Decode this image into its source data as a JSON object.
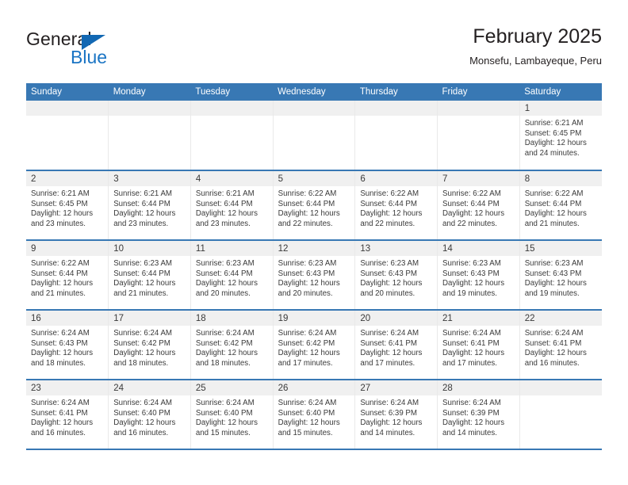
{
  "brand": {
    "name_part1": "General",
    "name_part2": "Blue",
    "logo_icon": "triangle-flag-icon",
    "accent_color": "#1268b3"
  },
  "header": {
    "title": "February 2025",
    "subtitle": "Monsefu, Lambayeque, Peru"
  },
  "theme": {
    "header_blue": "#3878b4",
    "daynum_band": "#f0f0f0",
    "text": "#3a3a3a"
  },
  "calendar": {
    "weekday_headers": [
      "Sunday",
      "Monday",
      "Tuesday",
      "Wednesday",
      "Thursday",
      "Friday",
      "Saturday"
    ],
    "weeks": [
      [
        {
          "empty": true
        },
        {
          "empty": true
        },
        {
          "empty": true
        },
        {
          "empty": true
        },
        {
          "empty": true
        },
        {
          "empty": true
        },
        {
          "day": "1",
          "sunrise": "Sunrise: 6:21 AM",
          "sunset": "Sunset: 6:45 PM",
          "daylight_line1": "Daylight: 12 hours",
          "daylight_line2": "and 24 minutes."
        }
      ],
      [
        {
          "day": "2",
          "sunrise": "Sunrise: 6:21 AM",
          "sunset": "Sunset: 6:45 PM",
          "daylight_line1": "Daylight: 12 hours",
          "daylight_line2": "and 23 minutes."
        },
        {
          "day": "3",
          "sunrise": "Sunrise: 6:21 AM",
          "sunset": "Sunset: 6:44 PM",
          "daylight_line1": "Daylight: 12 hours",
          "daylight_line2": "and 23 minutes."
        },
        {
          "day": "4",
          "sunrise": "Sunrise: 6:21 AM",
          "sunset": "Sunset: 6:44 PM",
          "daylight_line1": "Daylight: 12 hours",
          "daylight_line2": "and 23 minutes."
        },
        {
          "day": "5",
          "sunrise": "Sunrise: 6:22 AM",
          "sunset": "Sunset: 6:44 PM",
          "daylight_line1": "Daylight: 12 hours",
          "daylight_line2": "and 22 minutes."
        },
        {
          "day": "6",
          "sunrise": "Sunrise: 6:22 AM",
          "sunset": "Sunset: 6:44 PM",
          "daylight_line1": "Daylight: 12 hours",
          "daylight_line2": "and 22 minutes."
        },
        {
          "day": "7",
          "sunrise": "Sunrise: 6:22 AM",
          "sunset": "Sunset: 6:44 PM",
          "daylight_line1": "Daylight: 12 hours",
          "daylight_line2": "and 22 minutes."
        },
        {
          "day": "8",
          "sunrise": "Sunrise: 6:22 AM",
          "sunset": "Sunset: 6:44 PM",
          "daylight_line1": "Daylight: 12 hours",
          "daylight_line2": "and 21 minutes."
        }
      ],
      [
        {
          "day": "9",
          "sunrise": "Sunrise: 6:22 AM",
          "sunset": "Sunset: 6:44 PM",
          "daylight_line1": "Daylight: 12 hours",
          "daylight_line2": "and 21 minutes."
        },
        {
          "day": "10",
          "sunrise": "Sunrise: 6:23 AM",
          "sunset": "Sunset: 6:44 PM",
          "daylight_line1": "Daylight: 12 hours",
          "daylight_line2": "and 21 minutes."
        },
        {
          "day": "11",
          "sunrise": "Sunrise: 6:23 AM",
          "sunset": "Sunset: 6:44 PM",
          "daylight_line1": "Daylight: 12 hours",
          "daylight_line2": "and 20 minutes."
        },
        {
          "day": "12",
          "sunrise": "Sunrise: 6:23 AM",
          "sunset": "Sunset: 6:43 PM",
          "daylight_line1": "Daylight: 12 hours",
          "daylight_line2": "and 20 minutes."
        },
        {
          "day": "13",
          "sunrise": "Sunrise: 6:23 AM",
          "sunset": "Sunset: 6:43 PM",
          "daylight_line1": "Daylight: 12 hours",
          "daylight_line2": "and 20 minutes."
        },
        {
          "day": "14",
          "sunrise": "Sunrise: 6:23 AM",
          "sunset": "Sunset: 6:43 PM",
          "daylight_line1": "Daylight: 12 hours",
          "daylight_line2": "and 19 minutes."
        },
        {
          "day": "15",
          "sunrise": "Sunrise: 6:23 AM",
          "sunset": "Sunset: 6:43 PM",
          "daylight_line1": "Daylight: 12 hours",
          "daylight_line2": "and 19 minutes."
        }
      ],
      [
        {
          "day": "16",
          "sunrise": "Sunrise: 6:24 AM",
          "sunset": "Sunset: 6:43 PM",
          "daylight_line1": "Daylight: 12 hours",
          "daylight_line2": "and 18 minutes."
        },
        {
          "day": "17",
          "sunrise": "Sunrise: 6:24 AM",
          "sunset": "Sunset: 6:42 PM",
          "daylight_line1": "Daylight: 12 hours",
          "daylight_line2": "and 18 minutes."
        },
        {
          "day": "18",
          "sunrise": "Sunrise: 6:24 AM",
          "sunset": "Sunset: 6:42 PM",
          "daylight_line1": "Daylight: 12 hours",
          "daylight_line2": "and 18 minutes."
        },
        {
          "day": "19",
          "sunrise": "Sunrise: 6:24 AM",
          "sunset": "Sunset: 6:42 PM",
          "daylight_line1": "Daylight: 12 hours",
          "daylight_line2": "and 17 minutes."
        },
        {
          "day": "20",
          "sunrise": "Sunrise: 6:24 AM",
          "sunset": "Sunset: 6:41 PM",
          "daylight_line1": "Daylight: 12 hours",
          "daylight_line2": "and 17 minutes."
        },
        {
          "day": "21",
          "sunrise": "Sunrise: 6:24 AM",
          "sunset": "Sunset: 6:41 PM",
          "daylight_line1": "Daylight: 12 hours",
          "daylight_line2": "and 17 minutes."
        },
        {
          "day": "22",
          "sunrise": "Sunrise: 6:24 AM",
          "sunset": "Sunset: 6:41 PM",
          "daylight_line1": "Daylight: 12 hours",
          "daylight_line2": "and 16 minutes."
        }
      ],
      [
        {
          "day": "23",
          "sunrise": "Sunrise: 6:24 AM",
          "sunset": "Sunset: 6:41 PM",
          "daylight_line1": "Daylight: 12 hours",
          "daylight_line2": "and 16 minutes."
        },
        {
          "day": "24",
          "sunrise": "Sunrise: 6:24 AM",
          "sunset": "Sunset: 6:40 PM",
          "daylight_line1": "Daylight: 12 hours",
          "daylight_line2": "and 16 minutes."
        },
        {
          "day": "25",
          "sunrise": "Sunrise: 6:24 AM",
          "sunset": "Sunset: 6:40 PM",
          "daylight_line1": "Daylight: 12 hours",
          "daylight_line2": "and 15 minutes."
        },
        {
          "day": "26",
          "sunrise": "Sunrise: 6:24 AM",
          "sunset": "Sunset: 6:40 PM",
          "daylight_line1": "Daylight: 12 hours",
          "daylight_line2": "and 15 minutes."
        },
        {
          "day": "27",
          "sunrise": "Sunrise: 6:24 AM",
          "sunset": "Sunset: 6:39 PM",
          "daylight_line1": "Daylight: 12 hours",
          "daylight_line2": "and 14 minutes."
        },
        {
          "day": "28",
          "sunrise": "Sunrise: 6:24 AM",
          "sunset": "Sunset: 6:39 PM",
          "daylight_line1": "Daylight: 12 hours",
          "daylight_line2": "and 14 minutes."
        },
        {
          "empty": true
        }
      ]
    ]
  }
}
